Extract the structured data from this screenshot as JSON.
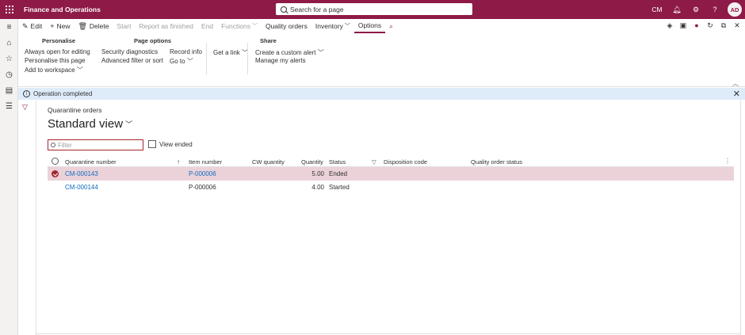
{
  "topbar": {
    "app_title": "Finance and Operations",
    "search_placeholder": "Search for a page",
    "company": "CM",
    "avatar_initials": "AD",
    "icons": [
      "bell-icon",
      "gear-icon",
      "help-icon"
    ]
  },
  "action_tabs": {
    "edit": "Edit",
    "new": "New",
    "delete": "Delete",
    "start": "Start",
    "report_finished": "Report as finished",
    "end": "End",
    "functions": "Functions",
    "quality_orders": "Quality orders",
    "inventory": "Inventory",
    "options": "Options"
  },
  "groups": {
    "personalise": {
      "title": "Personalise",
      "items": [
        "Always open for editing",
        "Personalise this page",
        "Add to workspace"
      ]
    },
    "page_options": {
      "title": "Page options",
      "col1": [
        "Security diagnostics",
        "Advanced filter or sort"
      ],
      "col2": [
        "Record info",
        "Go to"
      ]
    },
    "get_link": "Get a link",
    "share": {
      "title": "Share",
      "items": [
        "Create a custom alert",
        "Manage my alerts"
      ]
    }
  },
  "message": "Operation completed",
  "page": {
    "caption": "Quarantine orders",
    "view_name": "Standard view",
    "filter_placeholder": "Filter",
    "view_ended_label": "View ended"
  },
  "grid": {
    "columns": [
      "Quarantine number",
      "Item number",
      "CW quantity",
      "Quantity",
      "Status",
      "Disposition code",
      "Quality order status"
    ],
    "rows": [
      {
        "quarantine_number": "CM-000143",
        "item_number": "P-000006",
        "cw_quantity": "",
        "quantity": "5.00",
        "status": "Ended",
        "disposition_code": "",
        "quality_order_status": "",
        "selected": true
      },
      {
        "quarantine_number": "CM-000144",
        "item_number": "P-000006",
        "cw_quantity": "",
        "quantity": "4.00",
        "status": "Started",
        "disposition_code": "",
        "quality_order_status": "",
        "selected": false
      }
    ]
  },
  "colors": {
    "brand": "#8e1a47",
    "selected_row": "#ebd2d9",
    "info_bar": "#deecf9",
    "link": "#0f6cbd"
  }
}
